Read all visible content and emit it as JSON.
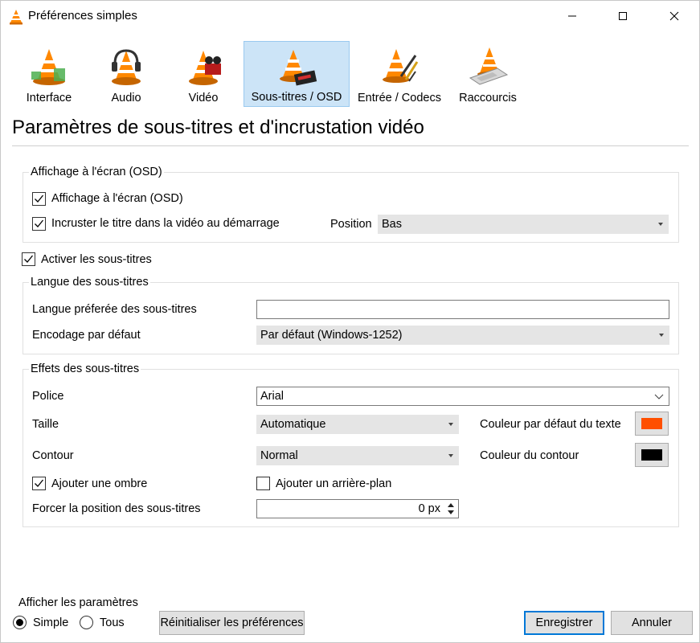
{
  "window": {
    "title": "Préférences simples"
  },
  "toolbar": {
    "items": [
      {
        "label": "Interface",
        "icon": "interface-icon"
      },
      {
        "label": "Audio",
        "icon": "audio-icon"
      },
      {
        "label": "Vidéo",
        "icon": "video-icon"
      },
      {
        "label": "Sous-titres / OSD",
        "icon": "subtitles-icon",
        "selected": true
      },
      {
        "label": "Entrée / Codecs",
        "icon": "codecs-icon"
      },
      {
        "label": "Raccourcis",
        "icon": "hotkeys-icon"
      }
    ]
  },
  "page": {
    "heading": "Paramètres de sous-titres et d'incrustation vidéo"
  },
  "osd": {
    "group_title": "Affichage à l'écran (OSD)",
    "osd_label": "Affichage à l'écran (OSD)",
    "osd_checked": true,
    "title_label": "Incruster le titre dans la vidéo au démarrage",
    "title_checked": true,
    "position_label": "Position",
    "position_value": "Bas"
  },
  "enable_subs": {
    "label": "Activer les sous-titres",
    "checked": true
  },
  "language": {
    "group_title": "Langue des sous-titres",
    "preferred_label": "Langue préferée des sous-titres",
    "preferred_value": "",
    "encoding_label": "Encodage par défaut",
    "encoding_value": "Par défaut (Windows-1252)"
  },
  "effects": {
    "group_title": "Effets des sous-titres",
    "font_label": "Police",
    "font_value": "Arial",
    "size_label": "Taille",
    "size_value": "Automatique",
    "text_color_label": "Couleur par défaut du texte",
    "text_color": "#ff4f00",
    "outline_label": "Contour",
    "outline_value": "Normal",
    "outline_color_label": "Couleur du contour",
    "outline_color": "#000000",
    "shadow_label": "Ajouter une ombre",
    "shadow_checked": true,
    "background_label": "Ajouter un arrière-plan",
    "background_checked": false,
    "force_position_label": "Forcer la position des sous-titres",
    "force_position_value": "0 px"
  },
  "show_settings": {
    "title": "Afficher les paramètres",
    "simple_label": "Simple",
    "all_label": "Tous",
    "selected": "Simple"
  },
  "buttons": {
    "reset": "Réinitialiser les préférences",
    "save": "Enregistrer",
    "cancel": "Annuler"
  },
  "colors": {
    "accent": "#0078d7",
    "selected_tab_bg": "#cce4f7",
    "vlc_orange": "#ff8800"
  }
}
